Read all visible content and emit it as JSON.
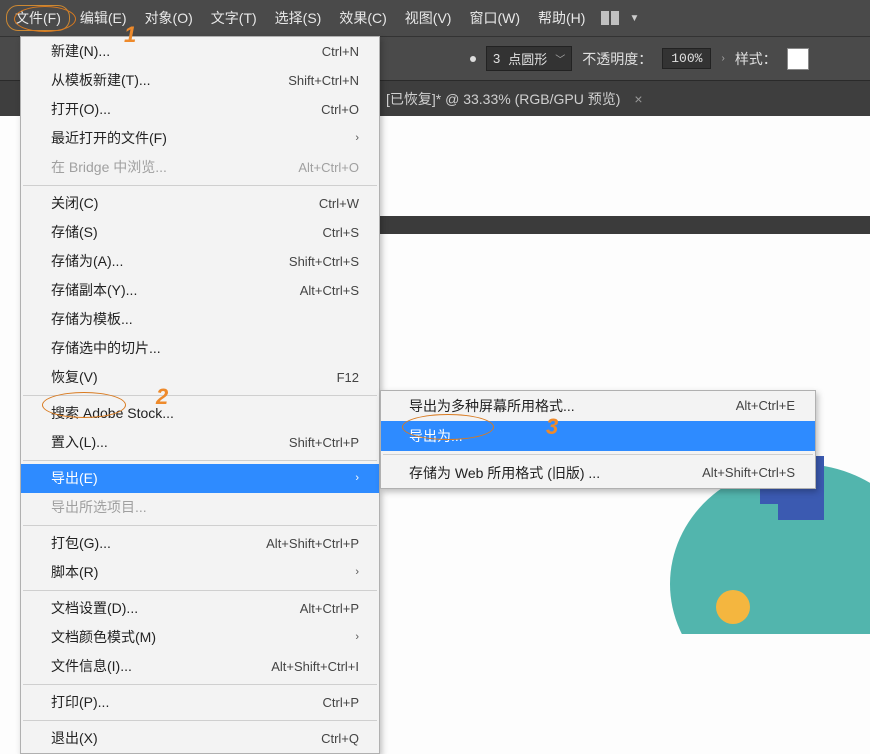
{
  "menubar": {
    "items": [
      "文件(F)",
      "编辑(E)",
      "对象(O)",
      "文字(T)",
      "选择(S)",
      "效果(C)",
      "视图(V)",
      "窗口(W)",
      "帮助(H)"
    ]
  },
  "optionsbar": {
    "stroke_size": "3",
    "stroke_type": "点圆形",
    "opacity_label": "不透明度：",
    "opacity_value": "100%",
    "style_label": "样式："
  },
  "tabbar": {
    "title": "[已恢复]* @ 33.33% (RGB/GPU 预览)"
  },
  "file_menu": {
    "groups": [
      [
        {
          "label": "新建(N)...",
          "shortcut": "Ctrl+N"
        },
        {
          "label": "从模板新建(T)...",
          "shortcut": "Shift+Ctrl+N"
        },
        {
          "label": "打开(O)...",
          "shortcut": "Ctrl+O"
        },
        {
          "label": "最近打开的文件(F)",
          "sub": true
        },
        {
          "label": "在 Bridge 中浏览...",
          "shortcut": "Alt+Ctrl+O",
          "disabled": true
        }
      ],
      [
        {
          "label": "关闭(C)",
          "shortcut": "Ctrl+W"
        },
        {
          "label": "存储(S)",
          "shortcut": "Ctrl+S"
        },
        {
          "label": "存储为(A)...",
          "shortcut": "Shift+Ctrl+S"
        },
        {
          "label": "存储副本(Y)...",
          "shortcut": "Alt+Ctrl+S"
        },
        {
          "label": "存储为模板..."
        },
        {
          "label": "存储选中的切片..."
        },
        {
          "label": "恢复(V)",
          "shortcut": "F12"
        }
      ],
      [
        {
          "label": "搜索 Adobe Stock..."
        },
        {
          "label": "置入(L)...",
          "shortcut": "Shift+Ctrl+P"
        }
      ],
      [
        {
          "label": "导出(E)",
          "sub": true,
          "hl": true
        },
        {
          "label": "导出所选项目...",
          "disabled": true
        }
      ],
      [
        {
          "label": "打包(G)...",
          "shortcut": "Alt+Shift+Ctrl+P"
        },
        {
          "label": "脚本(R)",
          "sub": true
        }
      ],
      [
        {
          "label": "文档设置(D)...",
          "shortcut": "Alt+Ctrl+P"
        },
        {
          "label": "文档颜色模式(M)",
          "sub": true
        },
        {
          "label": "文件信息(I)...",
          "shortcut": "Alt+Shift+Ctrl+I"
        }
      ],
      [
        {
          "label": "打印(P)...",
          "shortcut": "Ctrl+P"
        }
      ],
      [
        {
          "label": "退出(X)",
          "shortcut": "Ctrl+Q"
        }
      ]
    ]
  },
  "export_submenu": {
    "items": [
      {
        "label": "导出为多种屏幕所用格式...",
        "shortcut": "Alt+Ctrl+E"
      },
      {
        "label": "导出为...",
        "hl": true
      },
      {
        "sep": true
      },
      {
        "label": "存储为 Web 所用格式 (旧版) ...",
        "shortcut": "Alt+Shift+Ctrl+S"
      }
    ]
  },
  "annotations": {
    "n1": "1",
    "n2": "2",
    "n3": "3"
  }
}
